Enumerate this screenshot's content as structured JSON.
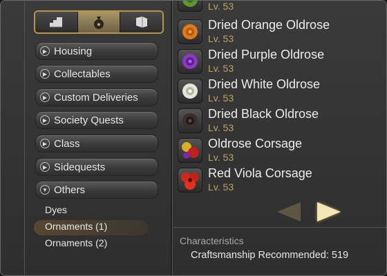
{
  "tabs": [
    {
      "name": "housing-tab-icon",
      "active": false
    },
    {
      "name": "moneybag-tab-icon",
      "active": true
    },
    {
      "name": "book-tab-icon",
      "active": false
    }
  ],
  "categories": [
    {
      "label": "Housing",
      "expanded": false
    },
    {
      "label": "Collectables",
      "expanded": false
    },
    {
      "label": "Custom Deliveries",
      "expanded": false
    },
    {
      "label": "Society Quests",
      "expanded": false
    },
    {
      "label": "Class",
      "expanded": false
    },
    {
      "label": "Sidequests",
      "expanded": false
    },
    {
      "label": "Others",
      "expanded": true
    }
  ],
  "subcategories": [
    "Dyes",
    "Ornaments (1)",
    "Ornaments (2)"
  ],
  "selected_subcategory": "Ornaments (1)",
  "items": [
    {
      "name": "",
      "level": "Lv. 53",
      "icon": "green-flower-icon",
      "color": "#5a9a2a"
    },
    {
      "name": "Dried Orange Oldrose",
      "level": "Lv. 53",
      "icon": "orange-rose-icon",
      "color": "#e07a1c"
    },
    {
      "name": "Dried Purple Oldrose",
      "level": "Lv. 53",
      "icon": "purple-rose-icon",
      "color": "#8a3ac0"
    },
    {
      "name": "Dried White Oldrose",
      "level": "Lv. 53",
      "icon": "white-rose-icon",
      "color": "#e6e6da"
    },
    {
      "name": "Dried Black Oldrose",
      "level": "Lv. 53",
      "icon": "black-rose-icon",
      "color": "#3a3030"
    },
    {
      "name": "Oldrose Corsage",
      "level": "Lv. 53",
      "icon": "corsage-icon",
      "color": "#d9b020"
    },
    {
      "name": "Red Viola Corsage",
      "level": "Lv. 53",
      "icon": "red-viola-icon",
      "color": "#d0281e"
    }
  ],
  "pager": {
    "prev_icon": "triangle-left-icon",
    "next_icon": "triangle-right-icon"
  },
  "characteristics": {
    "title": "Characteristics",
    "value": "Craftsmanship Recommended: 519"
  }
}
